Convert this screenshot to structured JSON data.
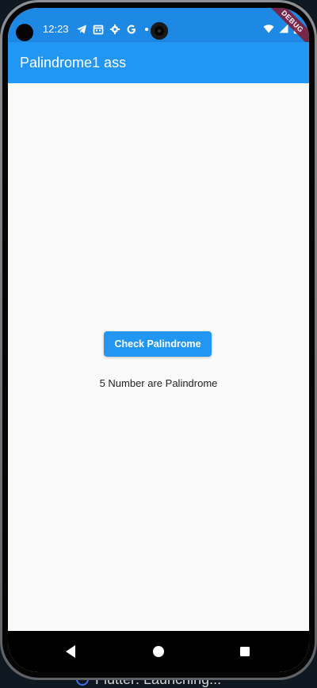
{
  "status_bar": {
    "time": "12:23",
    "icons": [
      "telegram-icon",
      "calendar-icon",
      "settings-icon",
      "google-icon",
      "notification-dot",
      "wifi-icon",
      "signal-icon",
      "battery-icon"
    ],
    "background": "#1e88e5"
  },
  "debug_banner": {
    "label": "DEBUG",
    "color": "#7f1f3c"
  },
  "app_bar": {
    "title": "Palindrome1 ass",
    "background": "#2196f3"
  },
  "main": {
    "button_label": "Check Palindrome",
    "result_text": "5 Number are Palindrome",
    "accent": "#2196f3"
  },
  "navigation": {
    "buttons": [
      "back-icon",
      "home-icon",
      "recents-icon"
    ]
  },
  "background_caption": {
    "text": "Flutter: Launching..."
  }
}
